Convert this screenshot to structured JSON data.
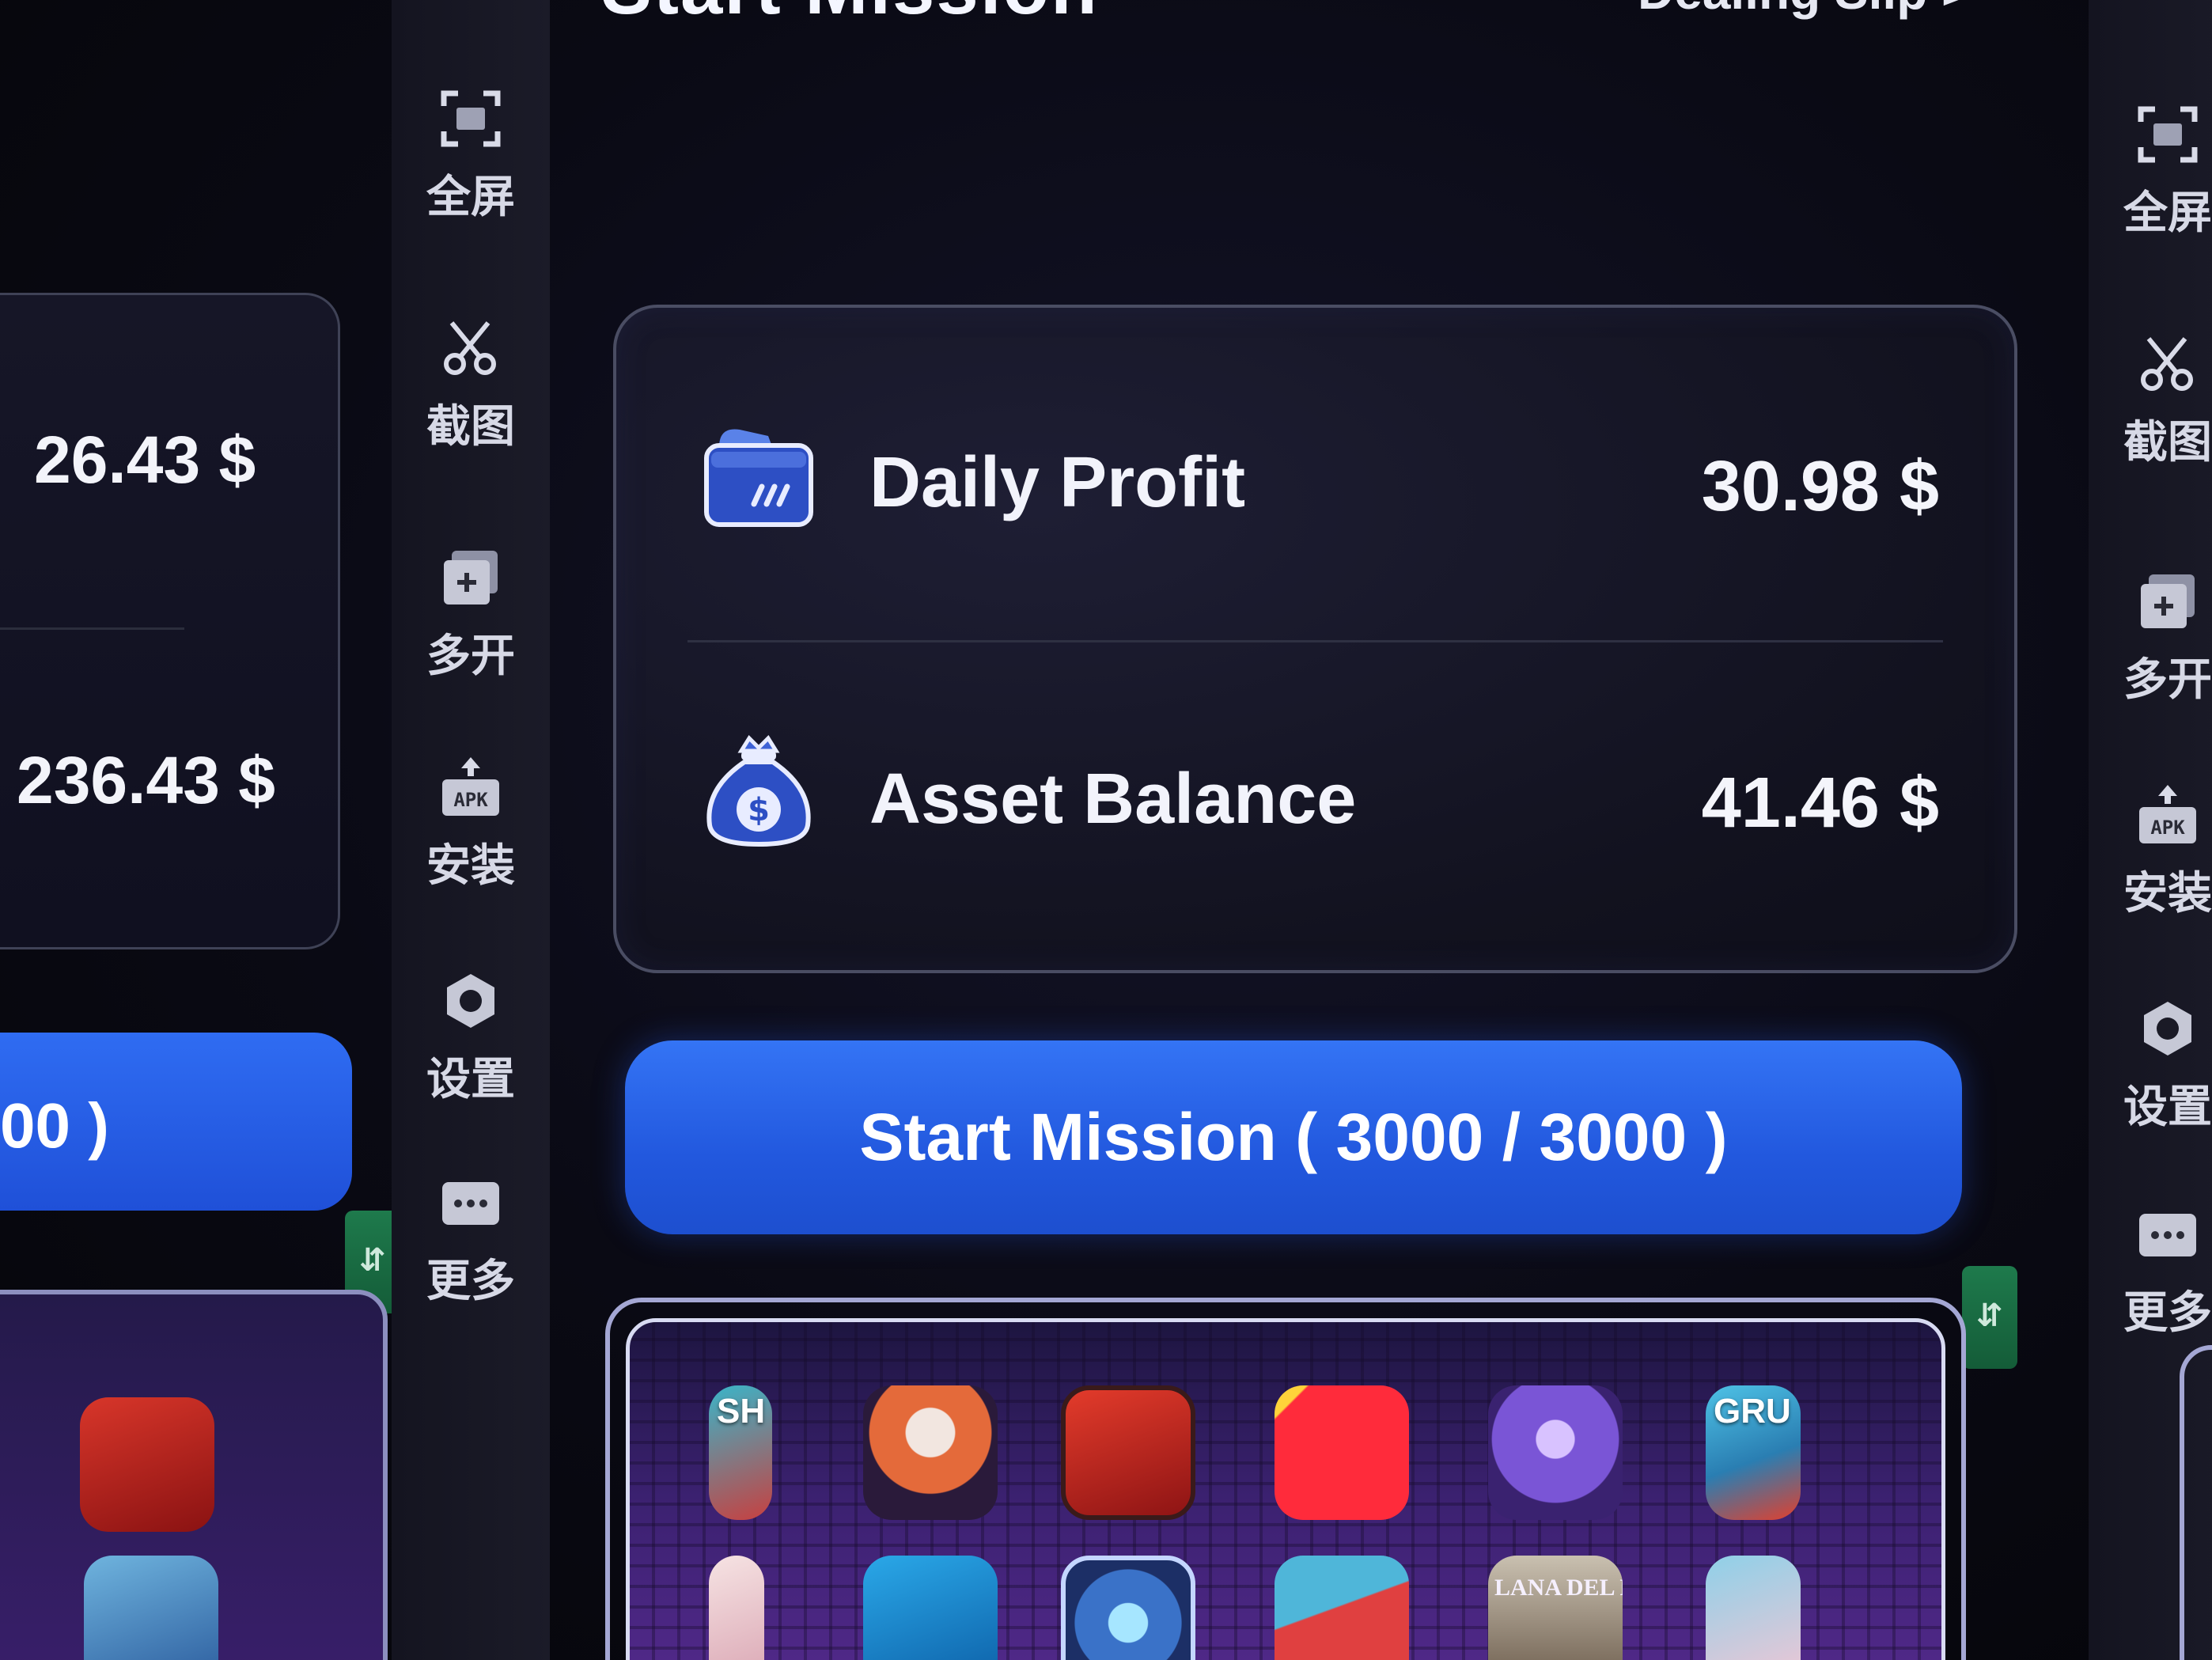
{
  "header": {
    "title": "Start Mission",
    "right_link": "Dealing Slip >",
    "left_fragment": "",
    "left_fragment2": "",
    "right_fragment": ""
  },
  "left_panel": {
    "value_1": "26.43 $",
    "value_2": "236.43 $",
    "button_label": "00 )"
  },
  "sidebar": {
    "items": [
      {
        "icon": "fullscreen-icon",
        "label": "全屏"
      },
      {
        "icon": "scissors-icon",
        "label": "截图"
      },
      {
        "icon": "multi-open-icon",
        "label": "多开"
      },
      {
        "icon": "apk-install-icon",
        "label": "安装"
      },
      {
        "icon": "settings-icon",
        "label": "设置"
      },
      {
        "icon": "more-icon",
        "label": "更多"
      }
    ]
  },
  "sidebar_right": {
    "items": [
      {
        "icon": "fullscreen-icon",
        "label": "全屏"
      },
      {
        "icon": "scissors-icon",
        "label": "截图"
      },
      {
        "icon": "multi-open-icon",
        "label": "多开"
      },
      {
        "icon": "apk-install-icon",
        "label": "安装"
      },
      {
        "icon": "settings-icon",
        "label": "设置"
      },
      {
        "icon": "more-icon",
        "label": "更多"
      }
    ]
  },
  "summary": {
    "daily_profit": {
      "label": "Daily Profit",
      "value": "30.98 $",
      "icon": "wallet-icon"
    },
    "asset_balance": {
      "label": "Asset Balance",
      "value": "41.46 $",
      "icon": "money-bag-icon"
    }
  },
  "mission_button": {
    "label": "Start Mission ( 3000 / 3000 )"
  },
  "apps": [
    {
      "name": "app-tile-1",
      "text": "SH"
    },
    {
      "name": "app-tile-2",
      "text": ""
    },
    {
      "name": "app-tile-3",
      "text": ""
    },
    {
      "name": "app-tile-4",
      "text": ""
    },
    {
      "name": "app-tile-5",
      "text": ""
    },
    {
      "name": "app-tile-6",
      "text": "GRU"
    },
    {
      "name": "app-tile-7",
      "text": ""
    },
    {
      "name": "app-tile-8",
      "text": ""
    },
    {
      "name": "app-tile-9",
      "text": ""
    },
    {
      "name": "app-tile-10",
      "text": ""
    },
    {
      "name": "app-tile-11",
      "text": "LANA DEL REY"
    },
    {
      "name": "app-tile-12",
      "text": ""
    }
  ],
  "colors": {
    "accent": "#2a63ea",
    "card_border": "#4a4d63",
    "background": "#0a0a14",
    "grid_border": "#a4a7d4"
  }
}
